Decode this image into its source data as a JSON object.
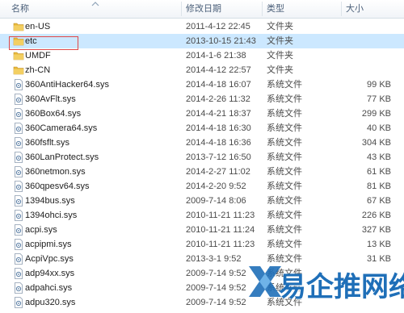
{
  "columns": {
    "name": "名称",
    "date": "修改日期",
    "type": "类型",
    "size": "大小"
  },
  "files": [
    {
      "name": "en-US",
      "date": "2011-4-12 22:45",
      "type": "文件夹",
      "size": "",
      "icon": "folder-icon"
    },
    {
      "name": "etc",
      "date": "2013-10-15 21:43",
      "type": "文件夹",
      "size": "",
      "icon": "folder-icon",
      "selected": true
    },
    {
      "name": "UMDF",
      "date": "2014-1-6 21:38",
      "type": "文件夹",
      "size": "",
      "icon": "folder-icon"
    },
    {
      "name": "zh-CN",
      "date": "2014-4-12 22:57",
      "type": "文件夹",
      "size": "",
      "icon": "folder-icon"
    },
    {
      "name": "360AntiHacker64.sys",
      "date": "2014-4-18 16:07",
      "type": "系统文件",
      "size": "99 KB",
      "icon": "system-file-icon"
    },
    {
      "name": "360AvFlt.sys",
      "date": "2014-2-26 11:32",
      "type": "系统文件",
      "size": "77 KB",
      "icon": "system-file-icon"
    },
    {
      "name": "360Box64.sys",
      "date": "2014-4-21 18:37",
      "type": "系统文件",
      "size": "299 KB",
      "icon": "system-file-icon"
    },
    {
      "name": "360Camera64.sys",
      "date": "2014-4-18 16:30",
      "type": "系统文件",
      "size": "40 KB",
      "icon": "system-file-icon"
    },
    {
      "name": "360fsflt.sys",
      "date": "2014-4-18 16:36",
      "type": "系统文件",
      "size": "304 KB",
      "icon": "system-file-icon"
    },
    {
      "name": "360LanProtect.sys",
      "date": "2013-7-12 16:50",
      "type": "系统文件",
      "size": "43 KB",
      "icon": "system-file-icon"
    },
    {
      "name": "360netmon.sys",
      "date": "2014-2-27 11:02",
      "type": "系统文件",
      "size": "61 KB",
      "icon": "system-file-icon"
    },
    {
      "name": "360qpesv64.sys",
      "date": "2014-2-20 9:52",
      "type": "系统文件",
      "size": "81 KB",
      "icon": "system-file-icon"
    },
    {
      "name": "1394bus.sys",
      "date": "2009-7-14 8:06",
      "type": "系统文件",
      "size": "67 KB",
      "icon": "system-file-icon"
    },
    {
      "name": "1394ohci.sys",
      "date": "2010-11-21 11:23",
      "type": "系统文件",
      "size": "226 KB",
      "icon": "system-file-icon"
    },
    {
      "name": "acpi.sys",
      "date": "2010-11-21 11:24",
      "type": "系统文件",
      "size": "327 KB",
      "icon": "system-file-icon"
    },
    {
      "name": "acpipmi.sys",
      "date": "2010-11-21 11:23",
      "type": "系统文件",
      "size": "13 KB",
      "icon": "system-file-icon"
    },
    {
      "name": "AcpiVpc.sys",
      "date": "2013-3-1 9:52",
      "type": "系统文件",
      "size": "31 KB",
      "icon": "system-file-icon"
    },
    {
      "name": "adp94xx.sys",
      "date": "2009-7-14 9:52",
      "type": "系统文件",
      "size": "",
      "icon": "system-file-icon"
    },
    {
      "name": "adpahci.sys",
      "date": "2009-7-14 9:52",
      "type": "系统文件",
      "size": "",
      "icon": "system-file-icon"
    },
    {
      "name": "adpu320.sys",
      "date": "2009-7-14 9:52",
      "type": "系统文件",
      "size": "",
      "icon": "system-file-icon"
    }
  ],
  "watermark": {
    "text": "易企推网络"
  },
  "colors": {
    "folder": "#e8b83a",
    "highlight": "#e04848",
    "selected_row": "#cce8ff",
    "watermark": "#1f6fb8"
  }
}
